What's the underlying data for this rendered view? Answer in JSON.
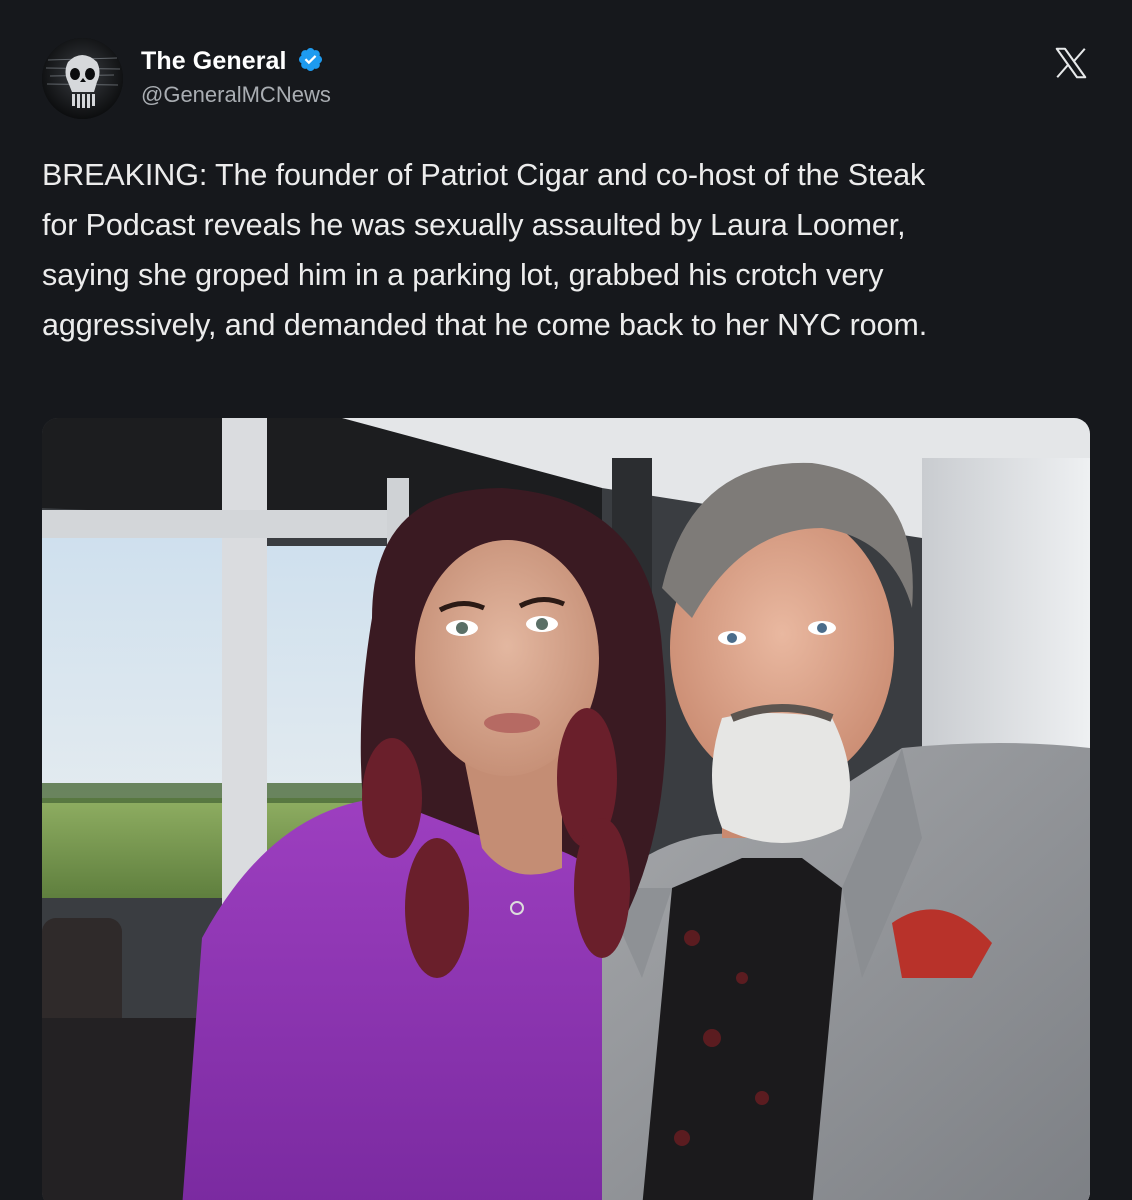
{
  "post": {
    "author": {
      "display_name": "The General",
      "handle": "@GeneralMCNews",
      "verified": true,
      "avatar_icon": "skull-avatar-icon"
    },
    "platform_icon": "x-logo-icon",
    "text": "BREAKING: The founder of Patriot Cigar and co-host of the Steak for Podcast reveals he was sexually assaulted by Laura Loomer, saying she groped him in a parking lot, grabbed his crotch very aggressively, and demanded that he come back to her NYC room.",
    "text_lines": [
      "BREAKING: The founder of Patriot Cigar and co-host of the Steak",
      "for Podcast reveals he was sexually assaulted by Laura Loomer,",
      "saying she groped him in a parking lot, grabbed his crotch very",
      "aggressively, and demanded that he come back to her NYC room."
    ]
  },
  "colors": {
    "background": "#16181c",
    "text": "#e7e9ea",
    "handle": "#a9adb2",
    "verified_badge": "#1d9bf0"
  }
}
